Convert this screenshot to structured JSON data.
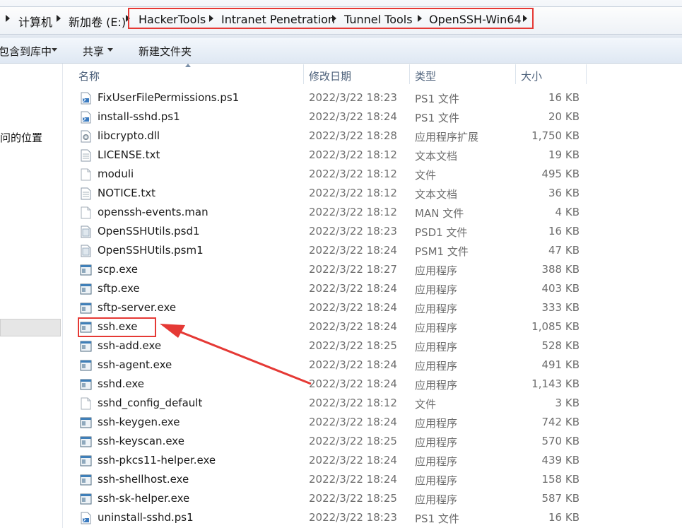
{
  "address_bar": {
    "crumbs": [
      "计算机",
      "新加卷 (E:)",
      "HackerTools",
      "Intranet Penetration",
      "Tunnel Tools",
      "OpenSSH-Win64"
    ]
  },
  "toolbar": {
    "include_in_library": "包含到库中",
    "share": "共享",
    "new_folder": "新建文件夹"
  },
  "nav": {
    "item_text": "问的位置"
  },
  "columns": {
    "name": "名称",
    "date": "修改日期",
    "type": "类型",
    "size": "大小"
  },
  "files": [
    {
      "name": "FixUserFilePermissions.ps1",
      "date": "2022/3/22 18:23",
      "type": "PS1 文件",
      "size": "16 KB",
      "icon": "ps1-icon"
    },
    {
      "name": "install-sshd.ps1",
      "date": "2022/3/22 18:24",
      "type": "PS1 文件",
      "size": "20 KB",
      "icon": "ps1-icon"
    },
    {
      "name": "libcrypto.dll",
      "date": "2022/3/22 18:28",
      "type": "应用程序扩展",
      "size": "1,750 KB",
      "icon": "dll-icon"
    },
    {
      "name": "LICENSE.txt",
      "date": "2022/3/22 18:12",
      "type": "文本文档",
      "size": "19 KB",
      "icon": "text-icon"
    },
    {
      "name": "moduli",
      "date": "2022/3/22 18:12",
      "type": "文件",
      "size": "495 KB",
      "icon": "blank-file-icon"
    },
    {
      "name": "NOTICE.txt",
      "date": "2022/3/22 18:12",
      "type": "文本文档",
      "size": "36 KB",
      "icon": "text-icon"
    },
    {
      "name": "openssh-events.man",
      "date": "2022/3/22 18:12",
      "type": "MAN 文件",
      "size": "4 KB",
      "icon": "blank-file-icon"
    },
    {
      "name": "OpenSSHUtils.psd1",
      "date": "2022/3/22 18:23",
      "type": "PSD1 文件",
      "size": "16 KB",
      "icon": "psd1-icon"
    },
    {
      "name": "OpenSSHUtils.psm1",
      "date": "2022/3/22 18:24",
      "type": "PSM1 文件",
      "size": "47 KB",
      "icon": "psd1-icon"
    },
    {
      "name": "scp.exe",
      "date": "2022/3/22 18:27",
      "type": "应用程序",
      "size": "388 KB",
      "icon": "exe-icon"
    },
    {
      "name": "sftp.exe",
      "date": "2022/3/22 18:24",
      "type": "应用程序",
      "size": "403 KB",
      "icon": "exe-icon"
    },
    {
      "name": "sftp-server.exe",
      "date": "2022/3/22 18:24",
      "type": "应用程序",
      "size": "333 KB",
      "icon": "exe-icon"
    },
    {
      "name": "ssh.exe",
      "date": "2022/3/22 18:24",
      "type": "应用程序",
      "size": "1,085 KB",
      "icon": "exe-icon"
    },
    {
      "name": "ssh-add.exe",
      "date": "2022/3/22 18:25",
      "type": "应用程序",
      "size": "528 KB",
      "icon": "exe-icon"
    },
    {
      "name": "ssh-agent.exe",
      "date": "2022/3/22 18:24",
      "type": "应用程序",
      "size": "491 KB",
      "icon": "exe-icon"
    },
    {
      "name": "sshd.exe",
      "date": "2022/3/22 18:24",
      "type": "应用程序",
      "size": "1,143 KB",
      "icon": "exe-icon"
    },
    {
      "name": "sshd_config_default",
      "date": "2022/3/22 18:12",
      "type": "文件",
      "size": "3 KB",
      "icon": "blank-file-icon"
    },
    {
      "name": "ssh-keygen.exe",
      "date": "2022/3/22 18:24",
      "type": "应用程序",
      "size": "742 KB",
      "icon": "exe-icon"
    },
    {
      "name": "ssh-keyscan.exe",
      "date": "2022/3/22 18:25",
      "type": "应用程序",
      "size": "570 KB",
      "icon": "exe-icon"
    },
    {
      "name": "ssh-pkcs11-helper.exe",
      "date": "2022/3/22 18:24",
      "type": "应用程序",
      "size": "439 KB",
      "icon": "exe-icon"
    },
    {
      "name": "ssh-shellhost.exe",
      "date": "2022/3/22 18:24",
      "type": "应用程序",
      "size": "158 KB",
      "icon": "exe-icon"
    },
    {
      "name": "ssh-sk-helper.exe",
      "date": "2022/3/22 18:25",
      "type": "应用程序",
      "size": "587 KB",
      "icon": "exe-icon"
    },
    {
      "name": "uninstall-sshd.ps1",
      "date": "2022/3/22 18:23",
      "type": "PS1 文件",
      "size": "16 KB",
      "icon": "ps1-icon"
    }
  ],
  "annotations": {
    "highlighted_file": "ssh.exe",
    "highlight_color": "#e53935"
  }
}
